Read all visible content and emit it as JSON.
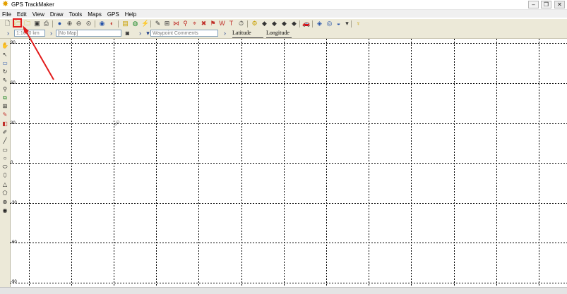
{
  "window": {
    "title": "GPS TrackMaker",
    "app_icon": "gps-trackmaker-icon"
  },
  "window_controls": {
    "minimize": "–",
    "maximize": "❐",
    "close": "✕"
  },
  "menu": [
    "File",
    "Edit",
    "View",
    "Draw",
    "Tools",
    "Maps",
    "GPS",
    "Help"
  ],
  "toolbar": {
    "icons": [
      "new-file-icon",
      "open-file-icon",
      "open-folder-icon",
      "save-icon",
      "print-icon",
      "zoom-tool-icon",
      "zoom-in-icon",
      "zoom-out-icon",
      "zoom-area-icon",
      "zoom-all-icon",
      "gps-receive-icon",
      "gps-send-icon",
      "map-properties-icon",
      "globe-icon",
      "track-tools-icon",
      "help-icon"
    ],
    "highlighted": "open-file-icon"
  },
  "toolbar2": {
    "scale_value": "1:1600 km",
    "map_value": "[No Map]",
    "waypoint_comments_value": "Waypoint Comments",
    "latitude_label": "Latitude",
    "longitude_label": "Longitude"
  },
  "map": {
    "y_axis_labels": [
      "90",
      "60",
      "30",
      "0",
      "-30",
      "-60",
      "-90"
    ],
    "grid": true
  },
  "annotation": {
    "arrow_color": "#e21b1b",
    "box_color": "#e21b1b"
  }
}
